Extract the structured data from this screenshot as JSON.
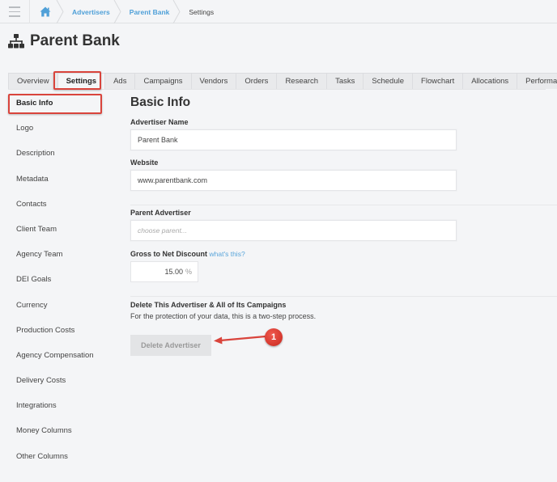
{
  "topbar": {
    "menu_icon": "hamburger-icon",
    "home_icon": "home-icon",
    "breadcrumbs": [
      {
        "label": "Advertisers",
        "link": true
      },
      {
        "label": "Parent Bank",
        "link": true
      },
      {
        "label": "Settings",
        "link": false
      }
    ]
  },
  "page": {
    "icon": "sitemap-icon",
    "title": "Parent Bank"
  },
  "tabs": [
    {
      "label": "Overview",
      "active": false
    },
    {
      "label": "Settings",
      "active": true
    },
    {
      "label": "Ads",
      "active": false
    },
    {
      "label": "Campaigns",
      "active": false
    },
    {
      "label": "Vendors",
      "active": false
    },
    {
      "label": "Orders",
      "active": false
    },
    {
      "label": "Research",
      "active": false
    },
    {
      "label": "Tasks",
      "active": false
    },
    {
      "label": "Schedule",
      "active": false
    },
    {
      "label": "Flowchart",
      "active": false
    },
    {
      "label": "Allocations",
      "active": false
    },
    {
      "label": "Performance",
      "active": false
    }
  ],
  "sidebar": {
    "items": [
      {
        "label": "Basic Info",
        "active": true
      },
      {
        "label": "Logo",
        "active": false
      },
      {
        "label": "Description",
        "active": false
      },
      {
        "label": "Metadata",
        "active": false
      },
      {
        "label": "Contacts",
        "active": false
      },
      {
        "label": "Client Team",
        "active": false
      },
      {
        "label": "Agency Team",
        "active": false
      },
      {
        "label": "DEI Goals",
        "active": false
      },
      {
        "label": "Currency",
        "active": false
      },
      {
        "label": "Production Costs",
        "active": false
      },
      {
        "label": "Agency Compensation",
        "active": false
      },
      {
        "label": "Delivery Costs",
        "active": false
      },
      {
        "label": "Integrations",
        "active": false
      },
      {
        "label": "Money Columns",
        "active": false
      },
      {
        "label": "Other Columns",
        "active": false
      }
    ]
  },
  "main": {
    "section_title": "Basic Info",
    "advertiser_name": {
      "label": "Advertiser Name",
      "value": "Parent Bank"
    },
    "website": {
      "label": "Website",
      "value": "www.parentbank.com"
    },
    "parent_advertiser": {
      "label": "Parent Advertiser",
      "placeholder": "choose parent..."
    },
    "gross_to_net": {
      "label": "Gross to Net Discount",
      "help_link": "what's this?",
      "value": "15.00",
      "unit": "%"
    },
    "delete": {
      "title": "Delete This Advertiser & All of Its Campaigns",
      "description": "For the protection of your data, this is a two-step process.",
      "button_label": "Delete Advertiser"
    }
  },
  "annotation": {
    "badge_number": "1",
    "highlight_color": "#d9443c"
  }
}
